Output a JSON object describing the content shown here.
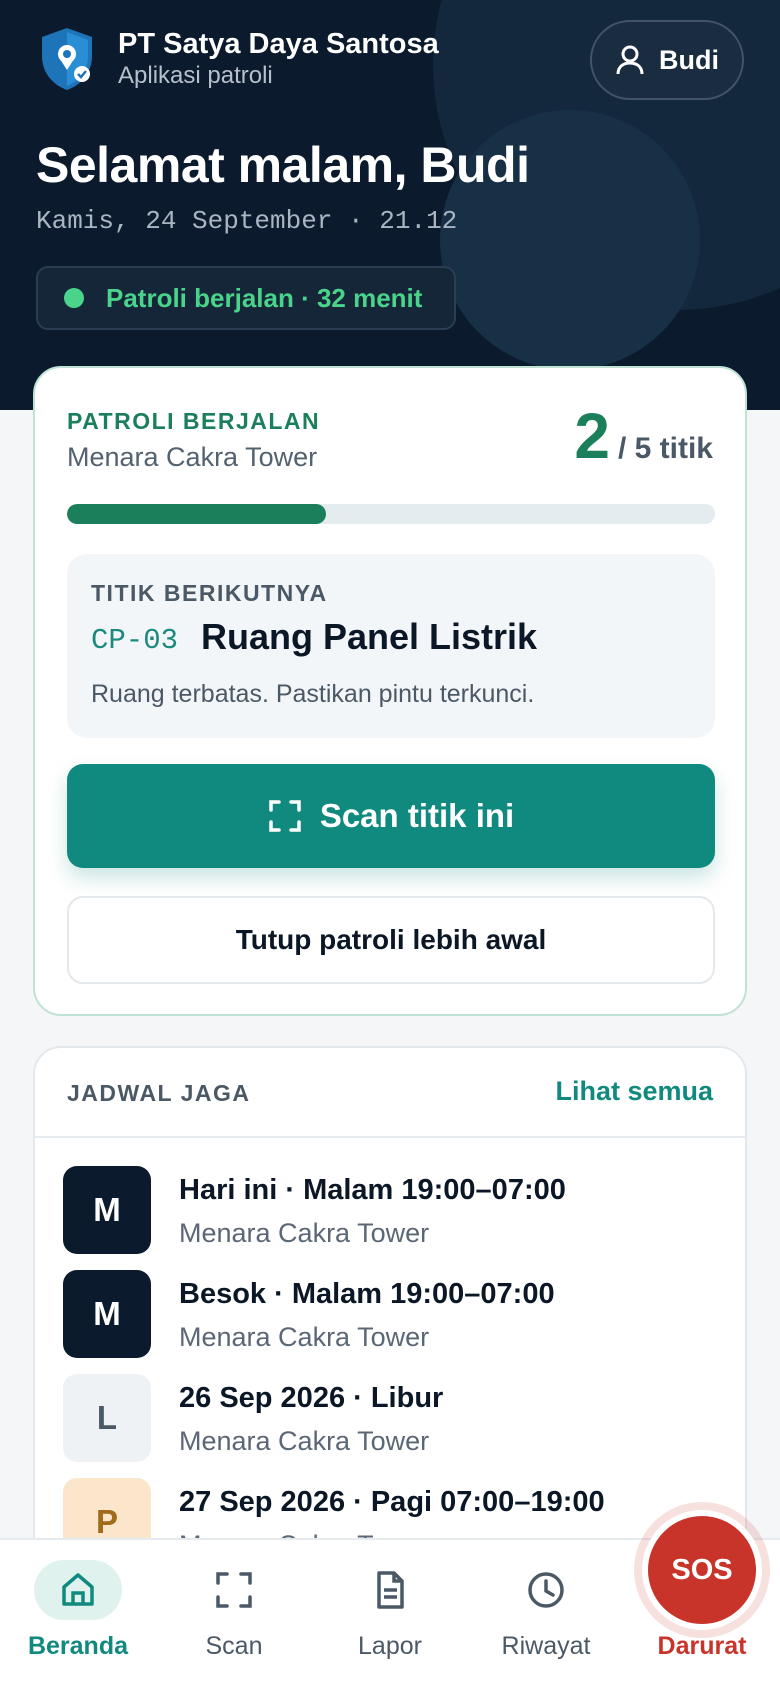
{
  "header": {
    "company": "PT Satya Daya Santosa",
    "app_subtitle": "Aplikasi patroli",
    "user_button": "Budi",
    "greeting": "Selamat malam, Budi",
    "datetime": "Kamis, 24 September · 21.12",
    "status": "Patroli berjalan · 32 menit"
  },
  "patrol": {
    "label": "PATROLI BERJALAN",
    "site": "Menara Cakra Tower",
    "done": "2",
    "total_label": "/ 5 titik",
    "progress_fraction": 0.4,
    "next_label": "TITIK BERIKUTNYA",
    "next_code": "CP-03",
    "next_name": "Ruang Panel Listrik",
    "next_note": "Ruang terbatas. Pastikan pintu terkunci.",
    "scan_button": "Scan titik ini",
    "close_button": "Tutup patroli lebih awal"
  },
  "schedule": {
    "title": "JADWAL JAGA",
    "see_all": "Lihat semua",
    "items": [
      {
        "badge": "M",
        "primary": "Hari ini · Malam 19:00–07:00",
        "secondary": "Menara Cakra Tower"
      },
      {
        "badge": "M",
        "primary": "Besok · Malam 19:00–07:00",
        "secondary": "Menara Cakra Tower"
      },
      {
        "badge": "L",
        "primary": "26 Sep 2026 · Libur",
        "secondary": "Menara Cakra Tower"
      },
      {
        "badge": "P",
        "primary": "27 Sep 2026 · Pagi 07:00–19:00",
        "secondary": "Menara Cakra Tower"
      }
    ]
  },
  "nav": {
    "home": "Beranda",
    "scan": "Scan",
    "report": "Lapor",
    "history": "Riwayat",
    "emergency": "Darurat",
    "sos": "SOS"
  },
  "colors": {
    "primary": "#10897e",
    "success": "#1a7f5a",
    "danger": "#c8342a",
    "hero": "#0b1a2c"
  }
}
